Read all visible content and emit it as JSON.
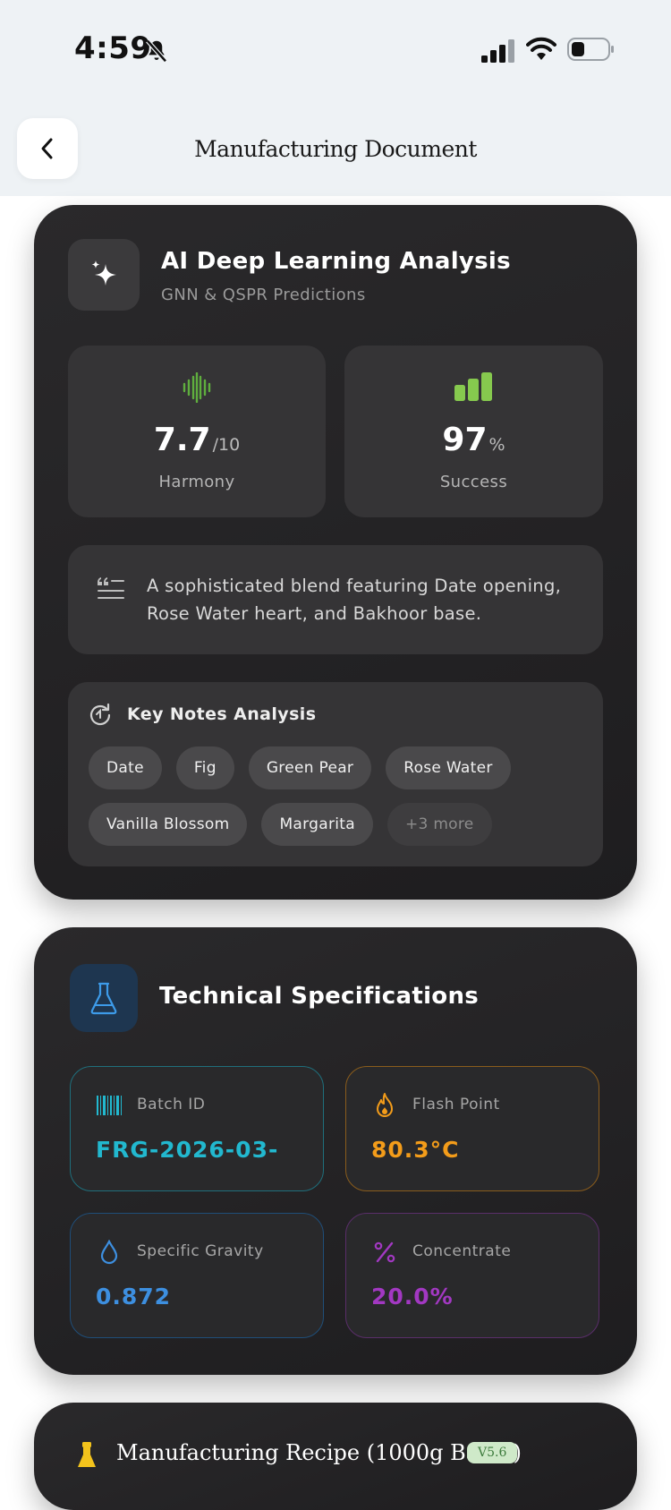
{
  "status_bar": {
    "time": "4:59"
  },
  "header": {
    "title": "Manufacturing Document"
  },
  "ai_analysis": {
    "title": "AI Deep Learning Analysis",
    "subtitle": "GNN & QSPR Predictions",
    "harmony": {
      "value": "7.7",
      "unit": "/10",
      "label": "Harmony"
    },
    "success": {
      "value": "97",
      "unit": "%",
      "label": "Success"
    },
    "description": "A sophisticated blend featuring Date opening, Rose Water heart, and Bakhoor base.",
    "key_notes": {
      "title": "Key Notes Analysis",
      "notes": [
        "Date",
        "Fig",
        "Green Pear",
        "Rose Water",
        "Vanilla Blossom",
        "Margarita"
      ],
      "more": "+3 more"
    }
  },
  "tech_specs": {
    "title": "Technical Specifications",
    "batch_id": {
      "label": "Batch ID",
      "value": "FRG-2026-03-",
      "color": "#22b8cf"
    },
    "flash_point": {
      "label": "Flash Point",
      "value": "80.3°C",
      "color": "#f39c1a"
    },
    "specific_gravity": {
      "label": "Specific Gravity",
      "value": "0.872",
      "color": "#3d8fe0"
    },
    "concentrate": {
      "label": "Concentrate",
      "value": "20.0%",
      "color": "#a238c2"
    }
  },
  "recipe": {
    "title": "Manufacturing Recipe (1000g Batch)",
    "version": "V5.6"
  }
}
